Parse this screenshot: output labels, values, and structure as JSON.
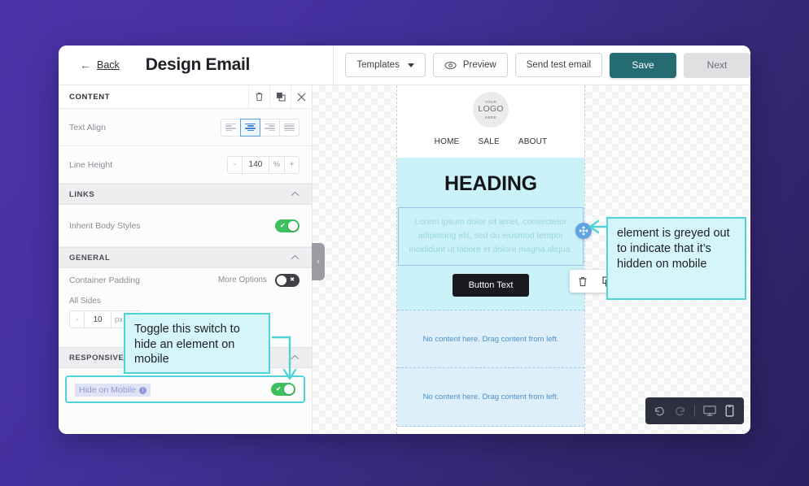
{
  "topbar": {
    "back_arrow": "←",
    "back_label": "Back",
    "title": "Design Email",
    "templates_label": "Templates",
    "preview_label": "Preview",
    "send_test_label": "Send test email",
    "save_label": "Save",
    "next_label": "Next",
    "save_color": "#256b72",
    "next_color": "#e0e0e3"
  },
  "sidebar": {
    "panel_title": "CONTENT",
    "actions": [
      {
        "name": "delete-icon"
      },
      {
        "name": "duplicate-icon"
      },
      {
        "name": "close-icon"
      }
    ],
    "text_align": {
      "label": "Text Align",
      "options": [
        "left",
        "center",
        "right",
        "justify"
      ],
      "selected": "center"
    },
    "line_height": {
      "label": "Line Height",
      "minus": "-",
      "value": "140",
      "unit": "%",
      "plus": "+"
    },
    "links_section": {
      "title": "LINKS",
      "chevron": "⌃",
      "inherit_label": "Inherit Body Styles",
      "inherit_on": true
    },
    "general_section": {
      "title": "GENERAL",
      "chevron": "⌃",
      "container_padding_label": "Container Padding",
      "more_options_label": "More Options",
      "more_options_on": false,
      "all_sides_label": "All Sides",
      "padding_minus": "-",
      "padding_value": "10",
      "padding_unit": "px",
      "padding_plus": "+"
    },
    "responsive_section": {
      "title": "RESPONSIVE DESIGN",
      "chevron": "⌃",
      "hide_on_mobile_label": "Hide on Mobile",
      "hide_on_mobile_info": "i",
      "hide_on_mobile_on": true,
      "highlight_color": "#4fd3d9"
    },
    "collapse_handle": "‹"
  },
  "canvas": {
    "email": {
      "logo": {
        "top": "YOUR",
        "main": "LOGO",
        "bottom": "HERE"
      },
      "nav": [
        "HOME",
        "SALE",
        "ABOUT"
      ],
      "heading": "HEADING",
      "body_text": "Lorem ipsum dolor sit amet, consectetur adipiscing elit, sed do eiusmod tempor incididunt ut labore et dolore magna aliqua.",
      "button_label": "Button Text",
      "mini_toolbar": [
        {
          "name": "delete-icon"
        },
        {
          "name": "duplicate-icon"
        }
      ],
      "drag_handle_icon": "move-icon",
      "drop_zones": [
        "No content here. Drag content from left.",
        "No content here. Drag content from left."
      ],
      "hero_bg": "#cbf2f8",
      "greyed_text_color": "#9ad4de"
    },
    "device_toolbar": [
      {
        "name": "undo-icon"
      },
      {
        "name": "redo-icon"
      },
      {
        "name": "desktop-icon"
      },
      {
        "name": "mobile-icon"
      }
    ]
  },
  "annotations": {
    "toggle_callout": "Toggle this switch to hide an element on mobile",
    "greyed_callout": "element is greyed out to indicate that it’s hidden on mobile",
    "color": "#4fd3d9",
    "fill": "#d4f6fa"
  }
}
